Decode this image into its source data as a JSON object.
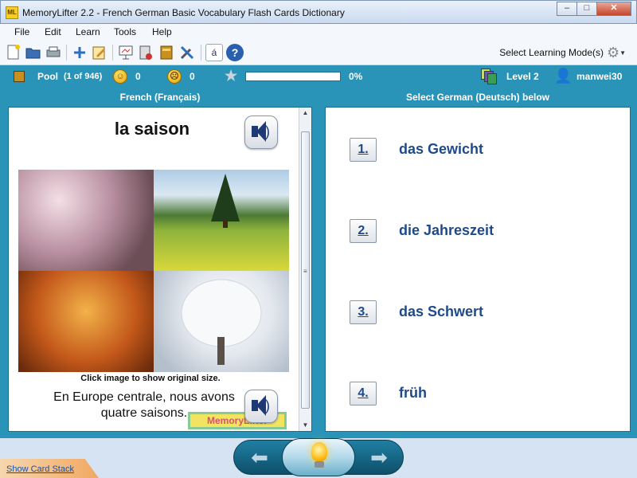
{
  "window": {
    "icon_text": "ML",
    "title": "MemoryLifter 2.2 - French German Basic Vocabulary Flash Cards Dictionary",
    "controls": [
      "–",
      "□",
      "✕"
    ]
  },
  "menu": [
    "File",
    "Edit",
    "Learn",
    "Tools",
    "Help"
  ],
  "toolbar": {
    "mode_label": "Select Learning Mode(s)",
    "char_button": "á",
    "help_button": "?"
  },
  "status": {
    "pool_label": "Pool",
    "pool_count": "(1 of 946)",
    "happy_count": "0",
    "sad_count": "0",
    "progress_percent": 0,
    "progress_text": "0%",
    "level": "Level 2",
    "user": "manwei30"
  },
  "question": {
    "header": "French (Français)",
    "word": "la saison",
    "caption": "Click image to show original size.",
    "sentence": "En Europe centrale, nous avons quatre saisons.",
    "stamp": "MemoryLifter"
  },
  "answers": {
    "header": "Select German (Deutsch) below",
    "items": [
      {
        "num": "1.",
        "text": "das Gewicht"
      },
      {
        "num": "2.",
        "text": "die Jahreszeit"
      },
      {
        "num": "3.",
        "text": "das Schwert"
      },
      {
        "num": "4.",
        "text": "früh"
      }
    ]
  },
  "footer": {
    "card_stack_link": "Show Card Stack",
    "prev_arrow": "⬅",
    "next_arrow": "➡"
  }
}
